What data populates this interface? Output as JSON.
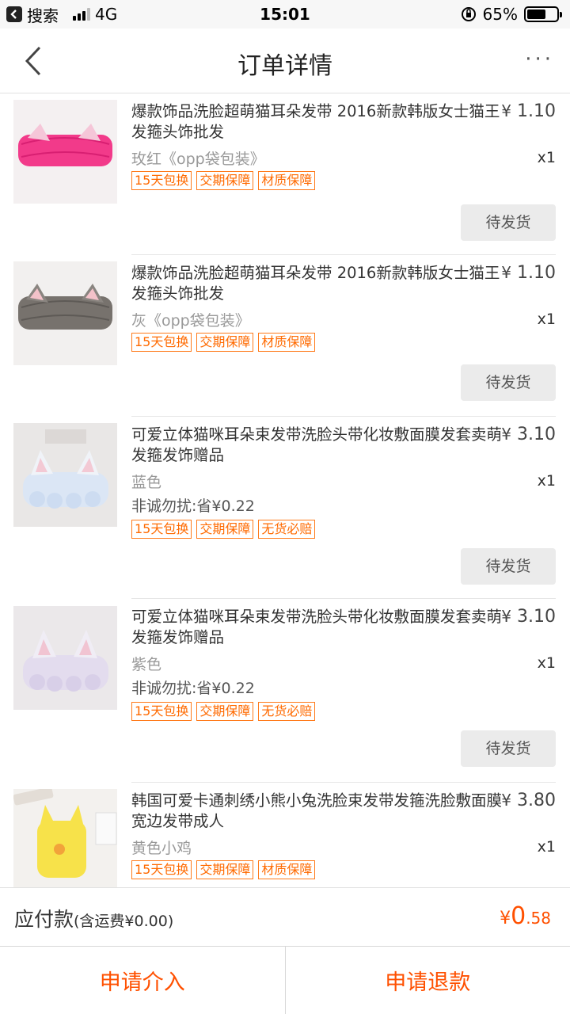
{
  "status_bar": {
    "back_app": "搜索",
    "network": "4G",
    "time": "15:01",
    "battery": "65%",
    "battery_level": 0.65
  },
  "nav": {
    "title": "订单详情",
    "more": "···"
  },
  "items": [
    {
      "title": "爆款饰品洗脸超萌猫耳朵发带 2016新款韩版女士猫王发箍头饰批发",
      "price": "1.10",
      "sku": "玫红《opp袋包装》",
      "note": "",
      "qty": "x1",
      "tags": [
        "15天包换",
        "交期保障",
        "材质保障"
      ],
      "status": "待发货"
    },
    {
      "title": "爆款饰品洗脸超萌猫耳朵发带 2016新款韩版女士猫王发箍头饰批发",
      "price": "1.10",
      "sku": "灰《opp袋包装》",
      "note": "",
      "qty": "x1",
      "tags": [
        "15天包换",
        "交期保障",
        "材质保障"
      ],
      "status": "待发货"
    },
    {
      "title": "可爱立体猫咪耳朵束发带洗脸头带化妆敷面膜发套卖萌发箍发饰赠品",
      "price": "3.10",
      "sku": "蓝色",
      "note": "非诚勿扰:省¥0.22",
      "qty": "x1",
      "tags": [
        "15天包换",
        "交期保障",
        "无货必赔"
      ],
      "status": "待发货"
    },
    {
      "title": "可爱立体猫咪耳朵束发带洗脸头带化妆敷面膜发套卖萌发箍发饰赠品",
      "price": "3.10",
      "sku": "紫色",
      "note": "非诚勿扰:省¥0.22",
      "qty": "x1",
      "tags": [
        "15天包换",
        "交期保障",
        "无货必赔"
      ],
      "status": "待发货"
    },
    {
      "title": "韩国可爱卡通刺绣小熊小兔洗脸束发带发箍洗脸敷面膜宽边发带成人",
      "price": "3.80",
      "sku": "黄色小鸡",
      "note": "",
      "qty": "x1",
      "tags": [
        "15天包换",
        "交期保障",
        "材质保障"
      ],
      "status": ""
    }
  ],
  "currency_symbol": "¥",
  "payment": {
    "label": "应付款",
    "shipping": "(含运费¥0.00)",
    "amount_symbol": "¥",
    "amount_int": "0",
    "amount_dec": ".58"
  },
  "actions": {
    "intervene": "申请介入",
    "refund": "申请退款"
  },
  "colors": {
    "accent": "#ff5000",
    "tag": "#ff6a00"
  }
}
